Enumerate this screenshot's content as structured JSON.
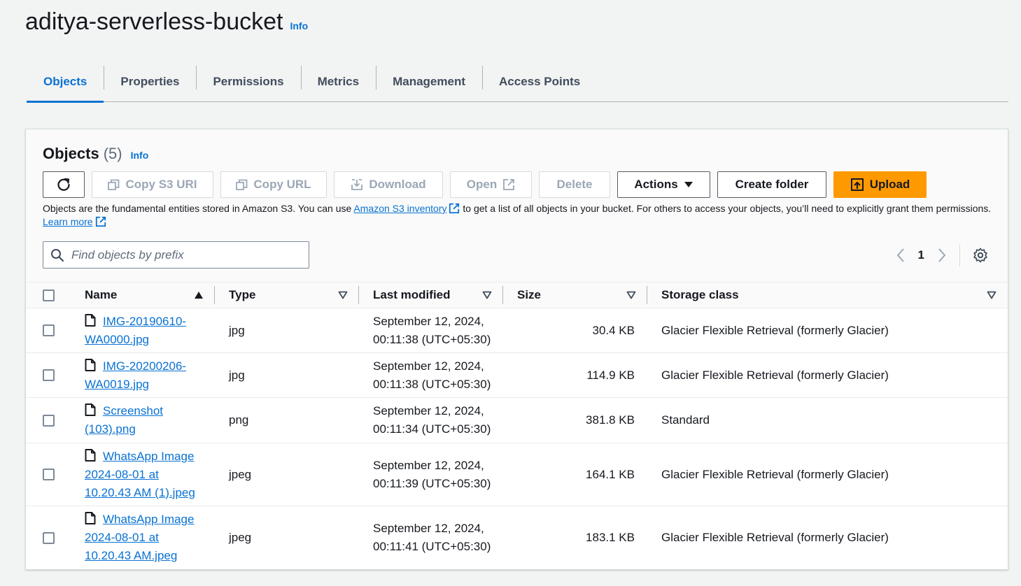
{
  "header": {
    "bucket_name": "aditya-serverless-bucket",
    "info_label": "Info"
  },
  "tabs": [
    {
      "label": "Objects",
      "active": true
    },
    {
      "label": "Properties",
      "active": false
    },
    {
      "label": "Permissions",
      "active": false
    },
    {
      "label": "Metrics",
      "active": false
    },
    {
      "label": "Management",
      "active": false
    },
    {
      "label": "Access Points",
      "active": false
    }
  ],
  "objects_panel": {
    "title": "Objects",
    "count": "(5)",
    "info_label": "Info",
    "toolbar": {
      "refresh_icon": "refresh-icon",
      "copy_s3_uri": "Copy S3 URI",
      "copy_url": "Copy URL",
      "download": "Download",
      "open": "Open",
      "delete": "Delete",
      "actions": "Actions",
      "create_folder": "Create folder",
      "upload": "Upload"
    },
    "description": {
      "part1": "Objects are the fundamental entities stored in Amazon S3. You can use ",
      "link1": "Amazon S3 inventory",
      "part2": " to get a list of all objects in your bucket. For others to access your objects, you’ll need to explicitly grant them permissions. ",
      "link2": "Learn more"
    },
    "search": {
      "placeholder": "Find objects by prefix"
    },
    "pagination": {
      "current_page": "1"
    },
    "columns": {
      "name": "Name",
      "type": "Type",
      "last_modified": "Last modified",
      "size": "Size",
      "storage_class": "Storage class"
    },
    "rows": [
      {
        "name": "IMG-20190610-WA0000.jpg",
        "type": "jpg",
        "modified_date": "September 12, 2024,",
        "modified_time": "00:11:38 (UTC+05:30)",
        "size": "30.4 KB",
        "storage_class": "Glacier Flexible Retrieval (formerly Glacier)"
      },
      {
        "name": "IMG-20200206-WA0019.jpg",
        "type": "jpg",
        "modified_date": "September 12, 2024,",
        "modified_time": "00:11:38 (UTC+05:30)",
        "size": "114.9 KB",
        "storage_class": "Glacier Flexible Retrieval (formerly Glacier)"
      },
      {
        "name": "Screenshot (103).png",
        "type": "png",
        "modified_date": "September 12, 2024,",
        "modified_time": "00:11:34 (UTC+05:30)",
        "size": "381.8 KB",
        "storage_class": "Standard"
      },
      {
        "name": "WhatsApp Image 2024-08-01 at 10.20.43 AM (1).jpeg",
        "type": "jpeg",
        "modified_date": "September 12, 2024,",
        "modified_time": "00:11:39 (UTC+05:30)",
        "size": "164.1 KB",
        "storage_class": "Glacier Flexible Retrieval (formerly Glacier)"
      },
      {
        "name": "WhatsApp Image 2024-08-01 at 10.20.43 AM.jpeg",
        "type": "jpeg",
        "modified_date": "September 12, 2024,",
        "modified_time": "00:11:41 (UTC+05:30)",
        "size": "183.1 KB",
        "storage_class": "Glacier Flexible Retrieval (formerly Glacier)"
      }
    ]
  },
  "colors": {
    "accent": "#0972d3",
    "upload_button": "#ff9900",
    "background": "#f2f3f3"
  }
}
